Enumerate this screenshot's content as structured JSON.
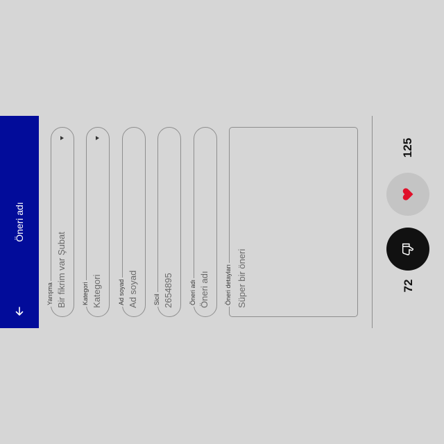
{
  "appbar": {
    "title": "Öneri adı",
    "back_icon": "arrow-left-icon",
    "background": "#020c9a"
  },
  "form": {
    "fields": [
      {
        "label": "Yarışma",
        "value": "Bir fikrim var Şubat",
        "type": "dropdown"
      },
      {
        "label": "Kategori",
        "value": "Kategori",
        "type": "dropdown"
      },
      {
        "label": "Ad soyad",
        "value": "Ad soyad",
        "type": "text"
      },
      {
        "label": "Sicil",
        "value": "2654895",
        "type": "text"
      },
      {
        "label": "Öneri adı",
        "value": "Öneri adı",
        "type": "text"
      }
    ],
    "details": {
      "label": "Öneri detayları",
      "value": "Süper bir öneri"
    }
  },
  "actions": {
    "dislike_count": "72",
    "like_count": "125",
    "dislike_icon": "thumbs-down-icon",
    "like_icon": "heart-icon",
    "heart_color": "#e0102a"
  }
}
